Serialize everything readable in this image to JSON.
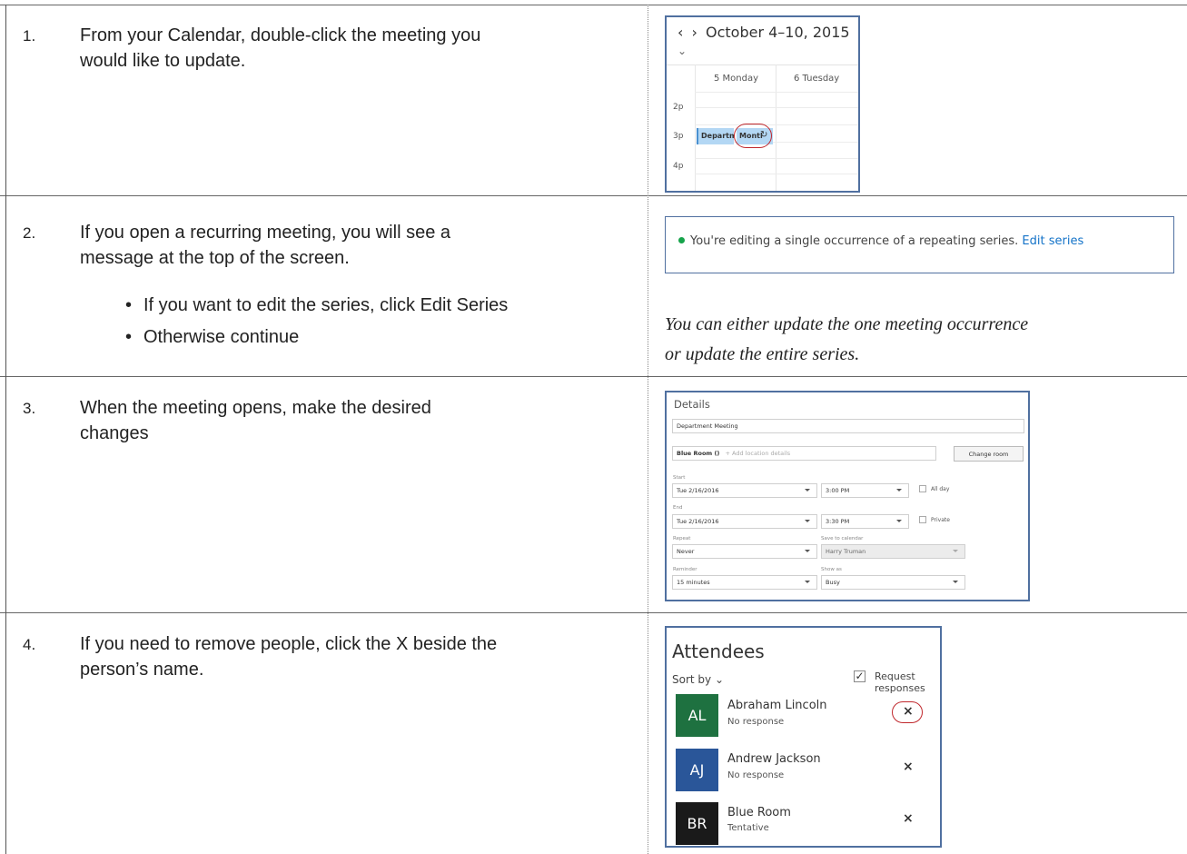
{
  "steps": [
    {
      "num": "1.",
      "lines": [
        "From your Calendar, double-click the meeting you",
        "would like to update."
      ]
    },
    {
      "num": "2.",
      "lines": [
        "If you open a recurring meeting, you will see a",
        "message at the top of the screen."
      ],
      "bullets": [
        "If you want to edit the series, click Edit Series",
        "Otherwise continue"
      ]
    },
    {
      "num": "3.",
      "lines": [
        "When the meeting opens, make the desired",
        "changes"
      ]
    },
    {
      "num": "4.",
      "lines": [
        "If you need to remove people, click the X beside the",
        "person’s name."
      ]
    }
  ],
  "note": [
    "You can either update the one meeting occurrence",
    "or update the entire series."
  ],
  "calendar": {
    "prev": "‹",
    "next": "›",
    "range": "October 4–10, 2015",
    "chevron": "⌄",
    "days": [
      "5 Monday",
      "6 Tuesday"
    ],
    "times": [
      "2p",
      "3p",
      "4p"
    ],
    "events": [
      "Departm",
      "Montl"
    ],
    "recurring_icon": "↻"
  },
  "banner": {
    "message": "You're editing a single occurrence of a repeating series.",
    "link": "Edit series"
  },
  "details": {
    "title": "Details",
    "subject": "Department Meeting",
    "room": "Blue Room ()",
    "location_placeholder": "+ Add location details",
    "change_room": "Change room",
    "start_label": "Start",
    "start_date": "Tue 2/16/2016",
    "start_time": "3:00 PM",
    "all_day": "All day",
    "end_label": "End",
    "end_date": "Tue 2/16/2016",
    "end_time": "3:30 PM",
    "private": "Private",
    "repeat_label": "Repeat",
    "repeat": "Never",
    "save_label": "Save to calendar",
    "save_to": "Harry Truman",
    "reminder_label": "Reminder",
    "reminder": "15 minutes",
    "show_as_label": "Show as",
    "show_as": "Busy"
  },
  "attendees": {
    "title": "Attendees",
    "sort": "Sort by ⌄",
    "checkmark": "✓",
    "request": "Request responses",
    "remove": "×",
    "people": [
      {
        "initials": "AL",
        "name": "Abraham Lincoln",
        "status": "No response",
        "color": "#1e7140"
      },
      {
        "initials": "AJ",
        "name": "Andrew Jackson",
        "status": "No response",
        "color": "#2a5699"
      },
      {
        "initials": "BR",
        "name": "Blue Room",
        "status": "Tentative",
        "color": "#1a1a1a"
      }
    ]
  }
}
